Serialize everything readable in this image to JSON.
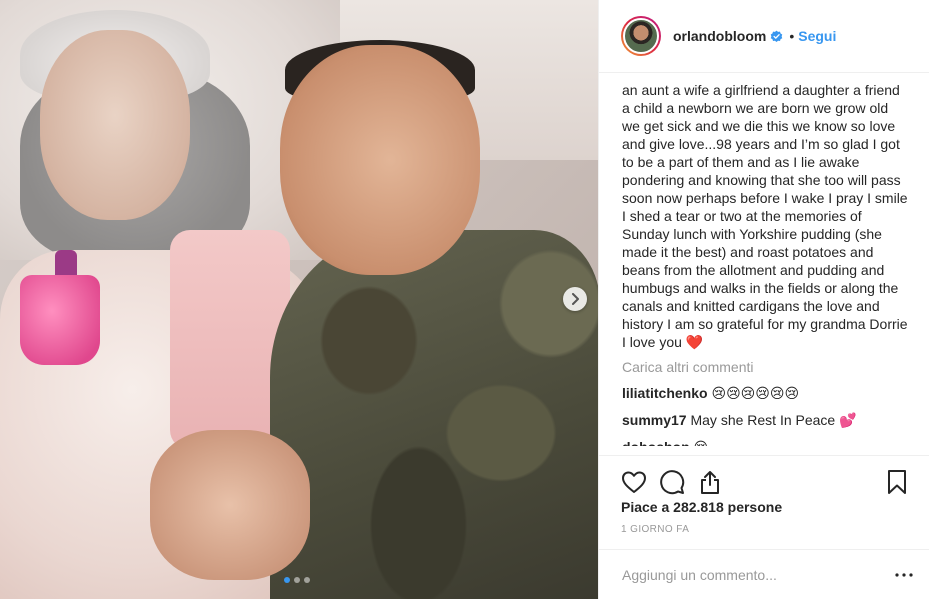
{
  "post": {
    "username": "orlandobloom",
    "separator": "•",
    "follow_label": "Segui",
    "caption": "an aunt a wife a girlfriend a daughter a friend a child a newborn we are born we grow old we get sick and we die this we know so love and give love...98 years and I’m so glad I got to be a part of them and as I lie awake pondering and knowing that she too will pass soon now perhaps before I wake I pray I smile I shed a tear or two at the memories of Sunday lunch with Yorkshire pudding (she made it the best) and roast potatoes and beans from the allotment and pudding and humbugs and walks in the fields or along the canals and knitted cardigans the love and history I am so grateful for my grandma Dorrie I love you",
    "caption_emoji": "❤️",
    "load_more_label": "Carica altri commenti",
    "comments": [
      {
        "user": "liliatitchenko",
        "text": "😢😢😢😢😢😢"
      },
      {
        "user": "summy17",
        "text": "May she Rest In Peace 💕"
      },
      {
        "user": "dohoshop",
        "text": "😢"
      }
    ],
    "likes_label": "Piace a 282.818 persone",
    "date_label": "1 giorno fa",
    "comment_placeholder": "Aggiungi un commento...",
    "carousel": {
      "total": 3,
      "active_index": 0
    }
  },
  "colors": {
    "accent": "#3897f0",
    "text": "#262626",
    "muted": "#999999",
    "border": "#efefef"
  },
  "icons": {
    "verified": "verified-badge-icon",
    "next": "chevron-right-icon",
    "like": "heart-icon",
    "comment": "comment-bubble-icon",
    "share": "share-icon",
    "save": "bookmark-icon",
    "more": "more-dots-icon"
  }
}
